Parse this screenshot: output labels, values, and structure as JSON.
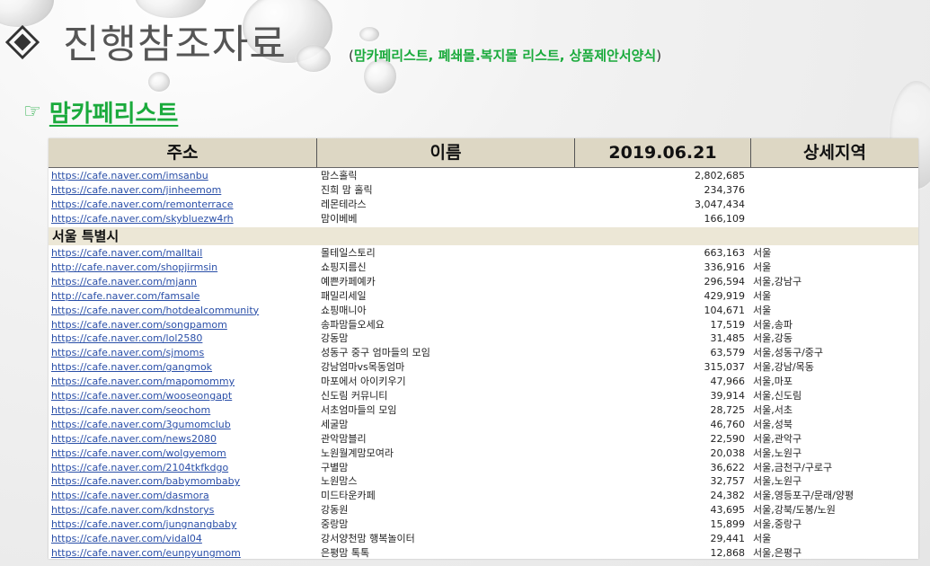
{
  "title": {
    "main": "진행참조자료",
    "paren_open": "(",
    "sub": "맘카페리스트, 폐쇄몰.복지몰 리스트, 상품제안서양식",
    "paren_close": ")"
  },
  "section": {
    "icon": "pointing-hand-icon",
    "icon_glyph": "☞",
    "title": "맘카페리스트"
  },
  "colors": {
    "accent_green": "#1aaa3c",
    "header_bg": "#ddd7c4",
    "link": "#2a4fa8"
  },
  "table": {
    "headers": [
      "주소",
      "이름",
      "2019.06.21",
      "상세지역"
    ],
    "top_rows": [
      {
        "url": "https://cafe.naver.com/imsanbu",
        "name": "맘스홀릭",
        "count": "2,802,685",
        "area": ""
      },
      {
        "url": "https://cafe.naver.com/jinheemom",
        "name": "진희 맘 홀릭",
        "count": "234,376",
        "area": ""
      },
      {
        "url": "https://cafe.naver.com/remonterrace",
        "name": "레몬테라스",
        "count": "3,047,434",
        "area": ""
      },
      {
        "url": "https://cafe.naver.com/skybluezw4rh",
        "name": "맘이베베",
        "count": "166,109",
        "area": ""
      }
    ],
    "seoul_label": "서울 특별시",
    "seoul_rows": [
      {
        "url": "https://cafe.naver.com/malltail",
        "name": "몰테일스토리",
        "count": "663,163",
        "area": "서울"
      },
      {
        "url": "http://cafe.naver.com/shopjirmsin",
        "name": "쇼핑지름신",
        "count": "336,916",
        "area": "서울"
      },
      {
        "url": "https://cafe.naver.com/mjann",
        "name": "예쁜카페예카",
        "count": "296,594",
        "area": "서울,강남구"
      },
      {
        "url": "http://cafe.naver.com/famsale",
        "name": "패밀리세일",
        "count": "429,919",
        "area": "서울"
      },
      {
        "url": "https://cafe.naver.com/hotdealcommunity",
        "name": "쇼핑매니아",
        "count": "104,671",
        "area": "서울"
      },
      {
        "url": "https://cafe.naver.com/songpamom",
        "name": "송파맘들오세요",
        "count": "17,519",
        "area": "서울,송파"
      },
      {
        "url": "https://cafe.naver.com/lol2580",
        "name": "강동맘",
        "count": "31,485",
        "area": "서울,강동"
      },
      {
        "url": "https://cafe.naver.com/sjmoms",
        "name": "성동구 중구 엄마들의 모임",
        "count": "63,579",
        "area": "서울,성동구/중구"
      },
      {
        "url": "https://cafe.naver.com/gangmok",
        "name": "강남엄마vs목동엄마",
        "count": "315,037",
        "area": "서울,강남/목동"
      },
      {
        "url": "https://cafe.naver.com/mapomommy",
        "name": "마포에서 아이키우기",
        "count": "47,966",
        "area": "서울,마포"
      },
      {
        "url": "https://cafe.naver.com/wooseongapt",
        "name": "신도림 커뮤니티",
        "count": "39,914",
        "area": "서울,신도림"
      },
      {
        "url": "https://cafe.naver.com/seochom",
        "name": "서초엄마들의 모임",
        "count": "28,725",
        "area": "서울,서초"
      },
      {
        "url": "https://cafe.naver.com/3gumomclub",
        "name": "세굴맘",
        "count": "46,760",
        "area": "서울,성북"
      },
      {
        "url": "https://cafe.naver.com/news2080",
        "name": "관악맘블리",
        "count": "22,590",
        "area": "서울,관악구"
      },
      {
        "url": "https://cafe.naver.com/wolgyemom",
        "name": "노원월계맘모여라",
        "count": "20,038",
        "area": "서울,노원구"
      },
      {
        "url": "https://cafe.naver.com/2104tkfkdgo",
        "name": "구별맘",
        "count": "36,622",
        "area": "서울,금천구/구로구"
      },
      {
        "url": "https://cafe.naver.com/babymombaby",
        "name": "노원맘스",
        "count": "32,757",
        "area": "서울,노원구"
      },
      {
        "url": "https://cafe.naver.com/dasmora",
        "name": "미드타운카페",
        "count": "24,382",
        "area": "서울,영등포구/문래/양평"
      },
      {
        "url": "https://cafe.naver.com/kdnstorys",
        "name": "강동원",
        "count": "43,695",
        "area": "서울,강북/도봉/노원"
      },
      {
        "url": "https://cafe.naver.com/jungnangbaby",
        "name": "중랑맘",
        "count": "15,899",
        "area": "서울,중랑구"
      },
      {
        "url": "https://cafe.naver.com/vidal04",
        "name": "강서양천맘 행복놀이터",
        "count": "29,441",
        "area": "서울"
      },
      {
        "url": "https://cafe.naver.com/eunpyungmom",
        "name": "은평맘 톡톡",
        "count": "12,868",
        "area": "서울,은평구"
      }
    ]
  }
}
